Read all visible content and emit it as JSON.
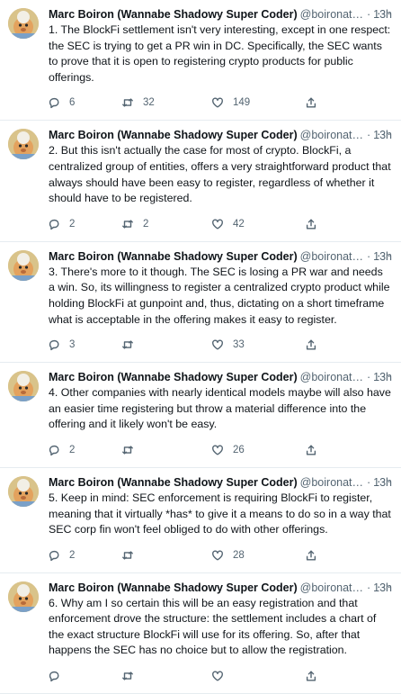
{
  "tweets": [
    {
      "name": "Marc Boiron (Wannabe Shadowy Super Coder)",
      "handle": "@boironattor...",
      "time": "13h",
      "text": "1. The BlockFi settlement isn't very interesting, except in one respect: the SEC is trying to get a PR win in DC. Specifically, the SEC wants to prove that it is open to registering crypto products for public offerings.",
      "replies": "6",
      "retweets": "32",
      "likes": "149"
    },
    {
      "name": "Marc Boiron (Wannabe Shadowy Super Coder)",
      "handle": "@boironattor...",
      "time": "13h",
      "text": "2. But this isn't actually the case for most of crypto. BlockFi, a centralized group of entities, offers a very straightforward product that always should have been easy to register, regardless of whether it should have to be registered.",
      "replies": "2",
      "retweets": "2",
      "likes": "42"
    },
    {
      "name": "Marc Boiron (Wannabe Shadowy Super Coder)",
      "handle": "@boironattor...",
      "time": "13h",
      "text": "3. There's more to it though. The SEC is losing a PR war and needs a win. So, its willingness to register a centralized crypto product while holding BlockFi at gunpoint and, thus, dictating on a short timeframe what is acceptable in the offering makes it easy to register.",
      "replies": "3",
      "retweets": "",
      "likes": "33"
    },
    {
      "name": "Marc Boiron (Wannabe Shadowy Super Coder)",
      "handle": "@boironattor...",
      "time": "13h",
      "text": "4. Other companies with nearly identical models maybe will also have an easier time registering but throw a material difference into the offering and it likely won't be easy.",
      "replies": "2",
      "retweets": "",
      "likes": "26"
    },
    {
      "name": "Marc Boiron (Wannabe Shadowy Super Coder)",
      "handle": "@boironattor...",
      "time": "13h",
      "text": "5. Keep in mind: SEC enforcement is requiring BlockFi to register, meaning that it virtually *has* to give it a means to do so in a way that SEC corp fin won't feel obliged to do with other offerings.",
      "replies": "2",
      "retweets": "",
      "likes": "28"
    },
    {
      "name": "Marc Boiron (Wannabe Shadowy Super Coder)",
      "handle": "@boironattor...",
      "time": "13h",
      "text": "6. Why am I so certain this will be an easy registration and that enforcement drove the structure: the settlement includes a chart of the exact structure BlockFi will use for its offering. So, after that happens the SEC has no choice but to allow the registration.",
      "replies": "",
      "retweets": "",
      "likes": ""
    }
  ],
  "more_label": "···",
  "dot": "·",
  "icons": [
    "reply-icon",
    "retweet-icon",
    "like-icon",
    "share-icon",
    "more-icon"
  ],
  "colors": {
    "text": "#0f1419",
    "secondary": "#536471",
    "divider": "#e6ecf0"
  }
}
